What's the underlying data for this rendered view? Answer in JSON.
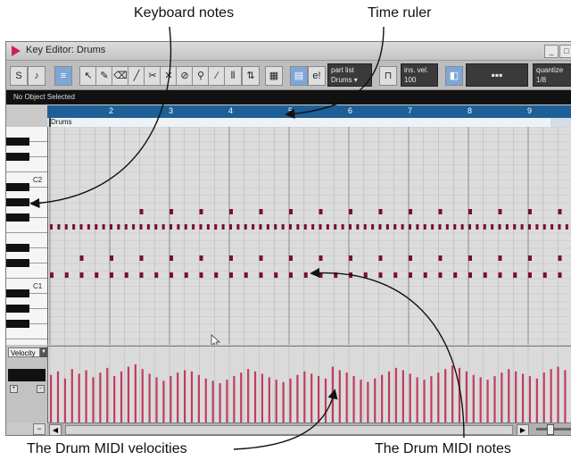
{
  "annotations": {
    "keyboard_notes": "Keyboard notes",
    "time_ruler": "Time ruler",
    "drum_velocities": "The Drum MIDI velocities",
    "drum_notes": "The Drum MIDI notes"
  },
  "window": {
    "title": "Key Editor: Drums"
  },
  "toolbar": {
    "part_list_label": "part list",
    "part_list_value": "Drums",
    "insert_velocity_label": "ins. vel.",
    "insert_velocity_value": "100",
    "quantize_label": "quantize",
    "quantize_value": "1/8",
    "edit_in_place_label": "e!"
  },
  "info_line": {
    "status": "No Object Selected"
  },
  "ruler": {
    "part_name": "Drums",
    "bars": [
      "2",
      "3",
      "4",
      "5",
      "6",
      "7",
      "8",
      "9"
    ]
  },
  "keyboard": {
    "labels": [
      "C2",
      "C1"
    ]
  },
  "controller_lane": {
    "selected": "Velocity"
  },
  "colors": {
    "note": "#7a1030",
    "velocity_bar": "#c23b5f",
    "ruler": "#1d5f96"
  },
  "notes_rows": [
    {
      "name": "row-upper",
      "step": 2,
      "offset": 6
    },
    {
      "name": "row-hihat",
      "step": 0.5,
      "offset": 0
    },
    {
      "name": "row-snare",
      "step": 2,
      "offset": 2
    },
    {
      "name": "row-kick",
      "step": 1,
      "offset": 0
    }
  ],
  "velocities": [
    82,
    88,
    76,
    92,
    84,
    90,
    78,
    86,
    94,
    80,
    88,
    96,
    100,
    92,
    84,
    78,
    72,
    80,
    86,
    90,
    88,
    82,
    76,
    72,
    68,
    74,
    80,
    86,
    92,
    88,
    84,
    78,
    74,
    70,
    76,
    82,
    88,
    84,
    80,
    76,
    96,
    90,
    86,
    80,
    74,
    70,
    76,
    82,
    88,
    94,
    90,
    84,
    78,
    74,
    80,
    86,
    92,
    98,
    94,
    88,
    82,
    78,
    74,
    80,
    86,
    92,
    88,
    84,
    80,
    76,
    86,
    92,
    96,
    90,
    84,
    78
  ]
}
